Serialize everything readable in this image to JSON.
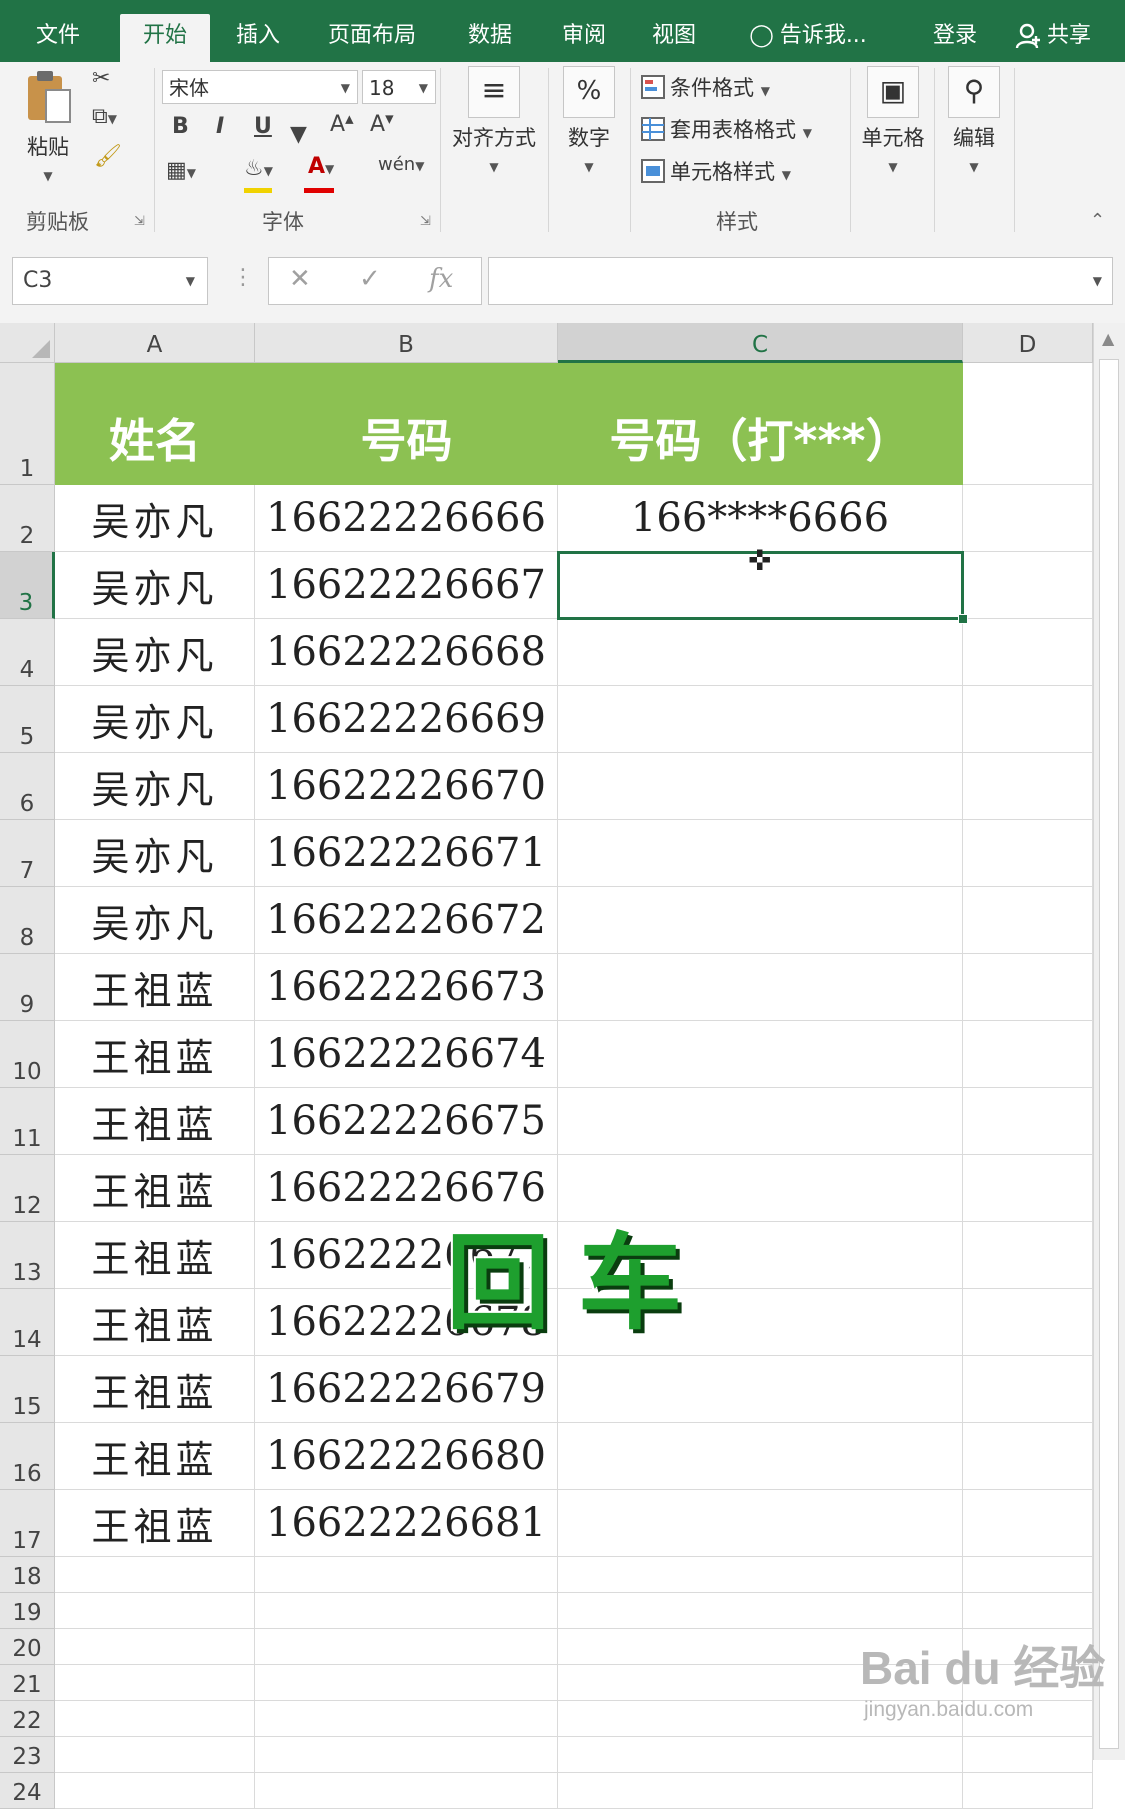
{
  "tabs": [
    "文件",
    "开始",
    "插入",
    "页面布局",
    "数据",
    "审阅",
    "视图",
    "告诉我..."
  ],
  "account": {
    "login": "登录",
    "share": "共享"
  },
  "ribbon": {
    "clipboard": {
      "paste": "粘贴",
      "group": "剪贴板"
    },
    "font": {
      "family": "宋体",
      "size": "18",
      "bold": "B",
      "italic": "I",
      "underline": "U",
      "grow": "A",
      "shrink": "A",
      "color_glyph": "A",
      "phonetic": "wén",
      "group": "字体"
    },
    "alignment": {
      "label": "对齐方式"
    },
    "number": {
      "icon": "%",
      "label": "数字"
    },
    "styles": {
      "conditional": "条件格式",
      "table": "套用表格格式",
      "cell_styles": "单元格样式",
      "group": "样式"
    },
    "cells": {
      "label": "单元格"
    },
    "editing": {
      "label": "编辑"
    }
  },
  "formula_bar": {
    "name_box": "C3",
    "fx": "fx",
    "formula": ""
  },
  "sheet": {
    "columns": [
      "A",
      "B",
      "C",
      "D"
    ],
    "selected_column": "C",
    "rows": [
      "1",
      "2",
      "3",
      "4",
      "5",
      "6",
      "7",
      "8",
      "9",
      "10",
      "11",
      "12",
      "13",
      "14",
      "15",
      "16",
      "17",
      "18",
      "19",
      "20",
      "21",
      "22",
      "23",
      "24"
    ],
    "selected_row": "3",
    "header": {
      "a": "姓名",
      "b": "号码",
      "c": "号码（打***）"
    },
    "data": [
      {
        "name": "吴亦凡",
        "phone": "16622226666",
        "masked": "166****6666"
      },
      {
        "name": "吴亦凡",
        "phone": "16622226667",
        "masked": ""
      },
      {
        "name": "吴亦凡",
        "phone": "16622226668",
        "masked": ""
      },
      {
        "name": "吴亦凡",
        "phone": "16622226669",
        "masked": ""
      },
      {
        "name": "吴亦凡",
        "phone": "16622226670",
        "masked": ""
      },
      {
        "name": "吴亦凡",
        "phone": "16622226671",
        "masked": ""
      },
      {
        "name": "吴亦凡",
        "phone": "16622226672",
        "masked": ""
      },
      {
        "name": "王祖蓝",
        "phone": "16622226673",
        "masked": ""
      },
      {
        "name": "王祖蓝",
        "phone": "16622226674",
        "masked": ""
      },
      {
        "name": "王祖蓝",
        "phone": "16622226675",
        "masked": ""
      },
      {
        "name": "王祖蓝",
        "phone": "16622226676",
        "masked": ""
      },
      {
        "name": "王祖蓝",
        "phone": "16622226677",
        "masked": ""
      },
      {
        "name": "王祖蓝",
        "phone": "16622226678",
        "masked": ""
      },
      {
        "name": "王祖蓝",
        "phone": "16622226679",
        "masked": ""
      },
      {
        "name": "王祖蓝",
        "phone": "16622226680",
        "masked": ""
      },
      {
        "name": "王祖蓝",
        "phone": "16622226681",
        "masked": ""
      }
    ]
  },
  "overlay": {
    "caption": "回车"
  },
  "watermark": {
    "brand": "Bai du 经验",
    "url": "jingyan.baidu.com"
  },
  "colors": {
    "excel_green": "#217346",
    "header_fill": "#8cc152",
    "caption_green": "#1e9f2e"
  }
}
